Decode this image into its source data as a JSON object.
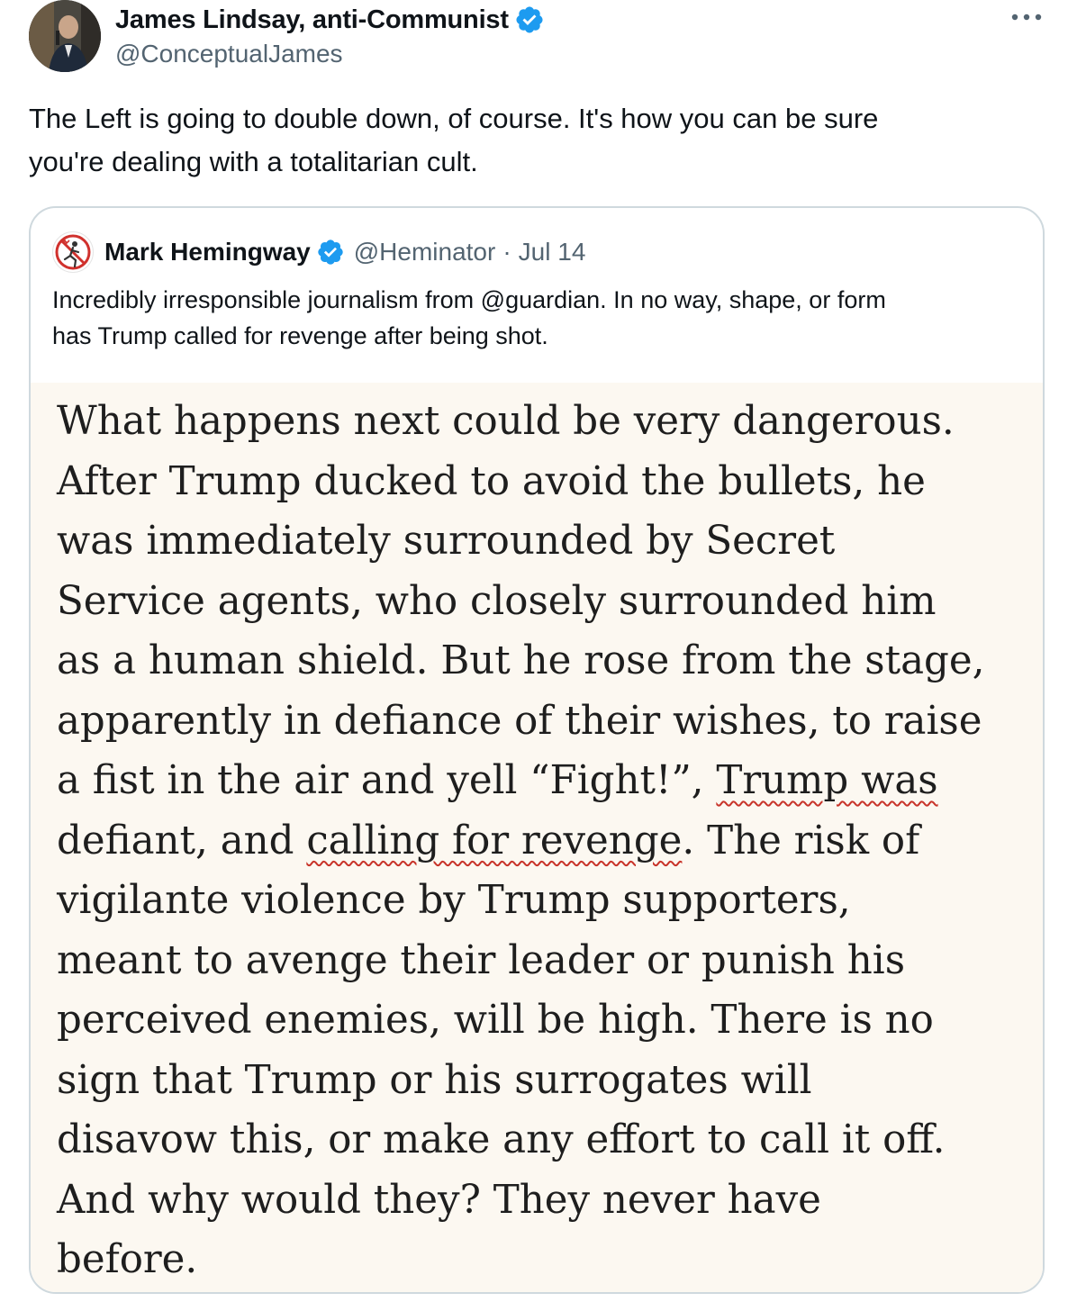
{
  "author": {
    "display_name": "James Lindsay, anti-Communist",
    "handle": "@ConceptualJames",
    "verified": true,
    "verified_color": "#1d9bf0"
  },
  "more_icon": "more-horizontal-icon",
  "tweet": {
    "text_lines": [
      "The Left is going to double down, of course. It's how you can be sure",
      "you're dealing with a totalitarian cult."
    ]
  },
  "quoted": {
    "display_name": "Mark Hemingway",
    "handle": "@Heminator",
    "separator": "·",
    "date": "Jul 14",
    "verified": true,
    "text_lines": [
      "Incredibly irresponsible journalism from @guardian. In no way, shape, or form",
      "has Trump called for revenge after being shot."
    ],
    "media": {
      "background": "#fcf8f1",
      "underline_color": "#c8342a",
      "lines": [
        {
          "text": "What happens next could be very dangerous."
        },
        {
          "text": "After Trump ducked to avoid the bullets, he"
        },
        {
          "text": "was immediately surrounded by Secret"
        },
        {
          "text": "Service agents, who closely surrounded him"
        },
        {
          "text": "as a human shield. But he rose from the stage,"
        },
        {
          "text": "apparently in defiance of their wishes, to raise"
        },
        {
          "pre": "a fist in the air and yell “Fight!”, ",
          "marked": "Trump was",
          "post": ""
        },
        {
          "pre": "defiant, and ",
          "marked": "calling for revenge",
          "post": ". The risk of"
        },
        {
          "text": "vigilante violence by Trump supporters,"
        },
        {
          "text": "meant to avenge their leader or punish his"
        },
        {
          "text": "perceived enemies, will be high. There is no"
        },
        {
          "text": "sign that Trump or his surrogates will"
        },
        {
          "text": "disavow this, or make any effort to call it off."
        },
        {
          "text": "And why would they? They never have"
        },
        {
          "text": "before."
        }
      ]
    }
  }
}
